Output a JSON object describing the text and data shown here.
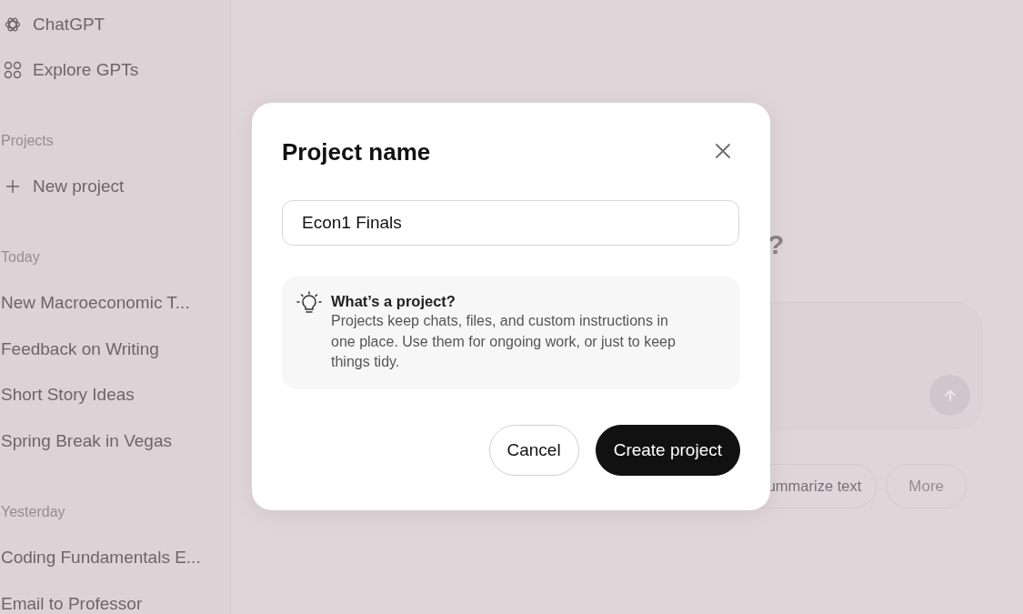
{
  "sidebar": {
    "top_items": [
      {
        "label": "ChatGPT",
        "kind": "chatgpt"
      },
      {
        "label": "Explore GPTs",
        "kind": "explore"
      }
    ],
    "projects": {
      "heading": "Projects",
      "new_project": "New project"
    },
    "history": [
      {
        "heading": "Today",
        "chats": [
          "New Macroeconomic T...",
          "Feedback on Writing",
          "Short Story Ideas",
          "Spring Break in Vegas"
        ]
      },
      {
        "heading": "Yesterday",
        "chats": [
          "Coding Fundamentals E...",
          "Email to Professor"
        ]
      }
    ]
  },
  "main": {
    "heading": "?",
    "suggestions": [
      "ummarize text",
      "More"
    ]
  },
  "dialog": {
    "title": "Project name",
    "name_value": "Econ1 Finals",
    "info": {
      "title": "What’s a project?",
      "body": "Projects keep chats, files, and custom instructions in one place. Use them for ongoing work, or just to keep things tidy."
    },
    "buttons": [
      {
        "label": "Cancel",
        "kind": "secondary"
      },
      {
        "label": "Create project",
        "kind": "primary"
      }
    ]
  }
}
